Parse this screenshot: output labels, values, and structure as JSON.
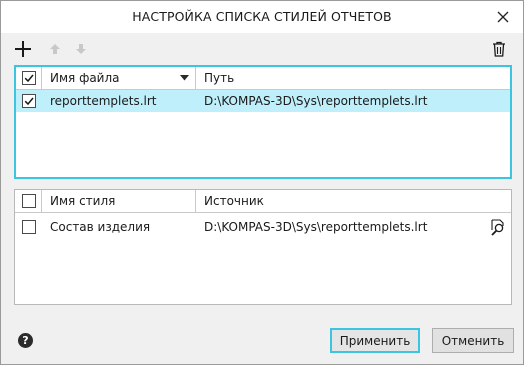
{
  "dialog": {
    "title": "НАСТРОЙКА СПИСКА СТИЛЕЙ ОТЧЕТОВ",
    "close_icon": "close-icon"
  },
  "toolbar": {
    "add_icon": "plus-icon",
    "up_icon": "arrow-up-icon",
    "down_icon": "arrow-down-icon",
    "delete_icon": "trash-icon"
  },
  "files_grid": {
    "columns": {
      "file": "Имя файла",
      "path": "Путь"
    },
    "header_checked": true,
    "sort_icon": "sort-down-triangle-icon",
    "rows": [
      {
        "checked": true,
        "file": "reporttemplets.lrt",
        "path": "D:\\KOMPAS-3D\\Sys\\reporttemplets.lrt",
        "selected": true
      }
    ]
  },
  "styles_grid": {
    "columns": {
      "style": "Имя стиля",
      "source": "Источник"
    },
    "header_checked": false,
    "rows": [
      {
        "checked": false,
        "style": "Состав изделия",
        "source": "D:\\KOMPAS-3D\\Sys\\reporttemplets.lrt",
        "action_icon": "preview-search-icon"
      }
    ]
  },
  "footer": {
    "help_icon": "help-icon",
    "help_glyph": "?",
    "apply_label": "Применить",
    "cancel_label": "Отменить"
  },
  "colors": {
    "accent": "#3cc5e0",
    "selection": "#bfeffa"
  }
}
